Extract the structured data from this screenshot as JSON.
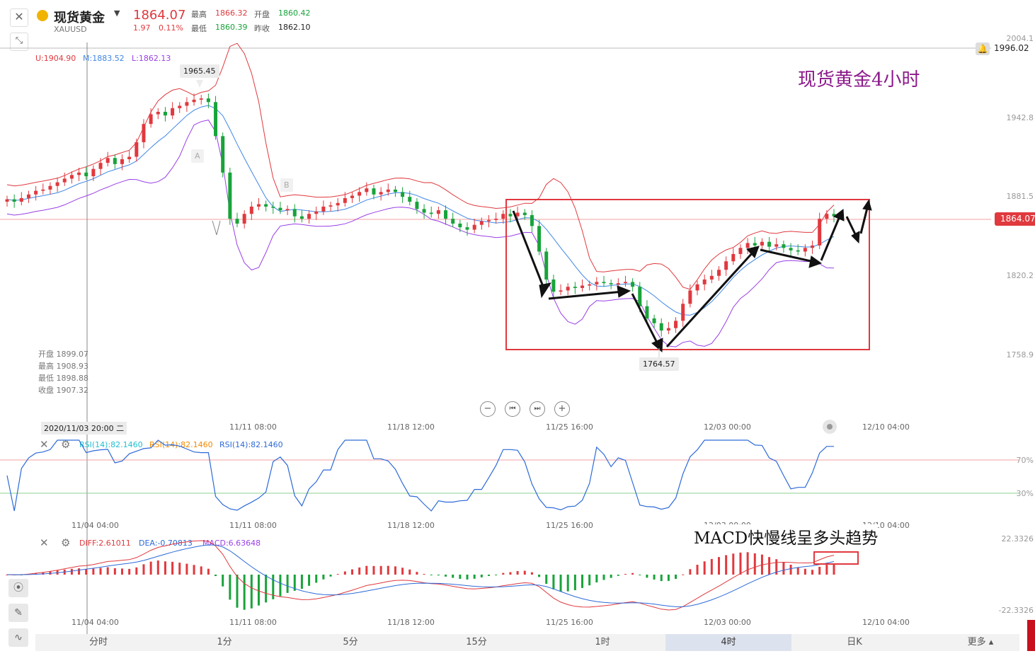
{
  "header": {
    "name": "现货黄金",
    "code": "XAUUSD",
    "price": "1864.07",
    "change": "1.97",
    "change_pct": "0.11%",
    "high_label": "最高",
    "high": "1866.32",
    "open_label": "开盘",
    "open": "1860.42",
    "low_label": "最低",
    "low": "1860.39",
    "prev_label": "昨收",
    "prev": "1862.10"
  },
  "boll": {
    "u": "U:1904.90",
    "m": "M:1883.52",
    "l": "L:1862.13"
  },
  "annotation_title": "现货黄金4小时",
  "macd_note": "MACD快慢线呈多头趋势",
  "ohlc_panel": {
    "open": "开盘 1899.07",
    "high": "最高 1908.93",
    "low": "最低 1898.88",
    "close": "收盘 1907.32"
  },
  "marks": {
    "high_peak": "1965.45",
    "low_trough": "1764.57",
    "A": "A",
    "B": "B"
  },
  "y_axis": {
    "top": "2004.1",
    "current_line": "1996.02",
    "l1": "1942.8",
    "l2": "1881.5",
    "current": "1864.07",
    "l3": "1820.2",
    "l4": "1758.9"
  },
  "x_axis": {
    "t0": "2020/11/03 20:00 二",
    "t1": "11/11 08:00",
    "t2": "11/18 12:00",
    "t3": "11/25 16:00",
    "t4": "12/03 00:00",
    "t5": "12/10 04:00",
    "t0b": "11/04 04:00"
  },
  "rsi": {
    "r1": "RSI(14):82.1460",
    "r2": "RSI(14):82.1460",
    "r3": "RSI(14):82.1460",
    "hi": "70%",
    "lo": "30%"
  },
  "macd": {
    "diff": "DIFF:2.61011",
    "dea": "DEA:-0.70813",
    "macd": "MACD:6.63648",
    "top": "22.3326",
    "bottom": "-22.3326"
  },
  "tabs": [
    "分时",
    "1分",
    "5分",
    "15分",
    "1时",
    "4时",
    "日K"
  ],
  "more": "更多",
  "colors": {
    "up": "#e0393e",
    "down": "#18a33a",
    "mid": "#3f87e6",
    "lower": "#9a3fe6",
    "upper": "#e0393e",
    "accent_box": "#e0393e",
    "title_purple": "#8b1a8b"
  },
  "chart_data": {
    "type": "candlestick",
    "title": "现货黄金4小时",
    "x_ticks": [
      "11/04 04:00",
      "11/11 08:00",
      "11/18 12:00",
      "11/25 16:00",
      "12/03 00:00",
      "12/10 04:00"
    ],
    "y_ticks": [
      2004.1,
      1942.8,
      1881.5,
      1820.2,
      1758.9
    ],
    "ylim": [
      1745,
      2010
    ],
    "marked_high": 1965.45,
    "marked_low": 1764.57,
    "current_price": 1864.07,
    "close_series": [
      1878,
      1876,
      1879,
      1882,
      1885,
      1886,
      1889,
      1892,
      1895,
      1898,
      1900,
      1897,
      1903,
      1908,
      1912,
      1907,
      1911,
      1913,
      1925,
      1940,
      1948,
      1950,
      1947,
      1953,
      1955,
      1958,
      1960,
      1961,
      1958,
      1930,
      1900,
      1862,
      1858,
      1866,
      1872,
      1874,
      1872,
      1871,
      1869,
      1870,
      1864,
      1862,
      1866,
      1868,
      1872,
      1873,
      1875,
      1879,
      1881,
      1884,
      1887,
      1882,
      1884,
      1886,
      1884,
      1880,
      1876,
      1870,
      1867,
      1866,
      1869,
      1862,
      1858,
      1855,
      1853,
      1857,
      1860,
      1861,
      1862,
      1866,
      1864,
      1867,
      1865,
      1856,
      1835,
      1812,
      1802,
      1803,
      1806,
      1805,
      1807,
      1808,
      1810,
      1809,
      1808,
      1809,
      1810,
      1806,
      1790,
      1780,
      1776,
      1770,
      1772,
      1778,
      1792,
      1803,
      1808,
      1812,
      1815,
      1820,
      1827,
      1833,
      1838,
      1842,
      1840,
      1843,
      1839,
      1841,
      1838,
      1836,
      1835,
      1838,
      1840,
      1862,
      1866,
      1864
    ],
    "rsi_ylim": [
      0,
      100
    ],
    "rsi_levels": [
      70,
      30
    ],
    "macd_ylim": [
      -22.3326,
      22.3326
    ]
  }
}
